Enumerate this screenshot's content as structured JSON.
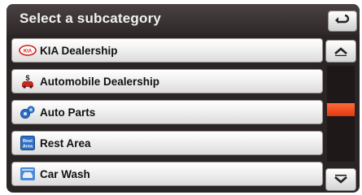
{
  "header": {
    "title": "Select a subcategory",
    "back_icon": "back-arrow-icon"
  },
  "items": [
    {
      "label": "KIA Dealership",
      "icon": "kia-logo-icon"
    },
    {
      "label": "Automobile Dealership",
      "icon": "car-dealer-icon"
    },
    {
      "label": "Auto Parts",
      "icon": "gears-icon"
    },
    {
      "label": "Rest Area",
      "icon": "rest-area-icon",
      "icon_text": "Rest Area"
    },
    {
      "label": "Car Wash",
      "icon": "car-wash-icon"
    }
  ],
  "scrollbar": {
    "position": 0.45
  },
  "colors": {
    "accent": "#e94a1c",
    "background": "#2b2424",
    "item": "#efeeee"
  }
}
